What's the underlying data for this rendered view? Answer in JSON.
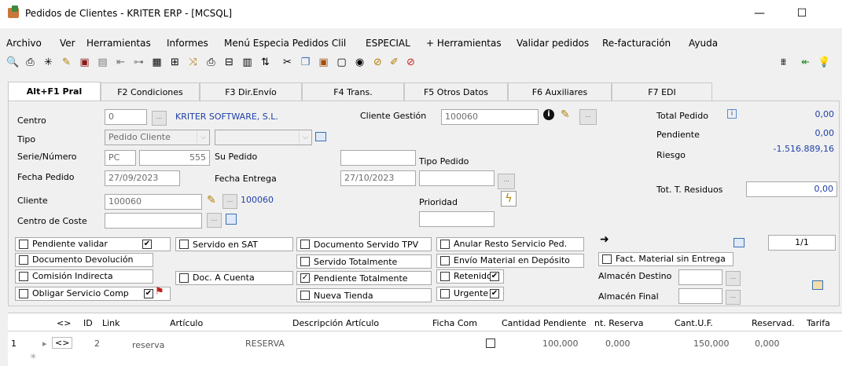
{
  "window": {
    "title": "Pedidos de Clientes - KRITER ERP - [MCSQL]",
    "minimize": "—",
    "maximize": "☐"
  },
  "menu": [
    "Archivo",
    "Ver",
    "Herramientas",
    "Informes",
    "Menú Especia Pedidos Clil",
    "ESPECIAL",
    "+ Herramientas",
    "Validar pedidos",
    "Re-facturación",
    "Ayuda"
  ],
  "tabs": [
    "Alt+F1 Pral",
    "F2 Condiciones",
    "F3 Dir.Envío",
    "F4 Trans.",
    "F5 Otros Datos",
    "F6 Auxiliares",
    "F7 EDI"
  ],
  "form": {
    "centro_label": "Centro",
    "centro_value": "0",
    "centro_name": "KRITER SOFTWARE, S.L.",
    "cliente_gestion_label": "Cliente Gestión",
    "cliente_gestion_value": "100060",
    "tipo_label": "Tipo",
    "tipo_value": "Pedido Cliente",
    "serie_label": "Serie/Número",
    "serie_value": "PC",
    "numero_value": "555",
    "su_pedido_label": "Su Pedido",
    "tipo_pedido_label": "Tipo Pedido",
    "fecha_pedido_label": "Fecha Pedido",
    "fecha_pedido_value": "27/09/2023",
    "fecha_entrega_label": "Fecha Entrega",
    "fecha_entrega_value": "27/10/2023",
    "cliente_label": "Cliente",
    "cliente_value": "100060",
    "cliente_link": "100060",
    "prioridad_label": "Prioridad",
    "centro_coste_label": "Centro de Coste"
  },
  "totals": {
    "total_pedido_label": "Total Pedido",
    "total_pedido_value": "0,00",
    "pendiente_label": "Pendiente",
    "pendiente_value": "0,00",
    "riesgo_label": "Riesgo",
    "riesgo_value": "-1.516.889,16",
    "residuos_label": "Tot. T. Residuos",
    "residuos_value": "0,00"
  },
  "checks": {
    "pendiente_validar": "Pendiente validar",
    "documento_devolucion": "Documento Devolución",
    "comision_indirecta": "Comisión Indirecta",
    "obligar_servicio": "Obligar Servicio Comp",
    "servido_sat": "Servido en SAT",
    "doc_a_cuenta": "Doc. A Cuenta",
    "doc_servido_tpv": "Documento Servido TPV",
    "servido_totalmente": "Servido Totalmente",
    "pendiente_totalmente": "Pendiente Totalmente",
    "nueva_tienda": "Nueva Tienda",
    "anular_resto": "Anular Resto Servicio Ped.",
    "envio_material": "Envío Material en Depósito",
    "retenido": "Retenido",
    "urgente": "Urgente",
    "fact_material": "Fact. Material sin Entrega",
    "almacen_destino": "Almacén Destino",
    "almacen_final": "Almacén Final",
    "page": "1/1"
  },
  "grid": {
    "headers": [
      "<>",
      "ID",
      "Link",
      "Artículo",
      "Descripción Artículo",
      "Ficha Com",
      "Cantidad Pendiente",
      "nt. Reserva",
      "Cant.U.F.",
      "Reservad.",
      "Tarifa"
    ],
    "row": {
      "num": "1",
      "arrow": "<>",
      "id": "2",
      "articulo": "reserva",
      "descripcion": "RESERVA",
      "cantidad_pendiente": "100,000",
      "reserva": "0,000",
      "cant_uf": "150,000",
      "reservado": "0,000"
    }
  }
}
